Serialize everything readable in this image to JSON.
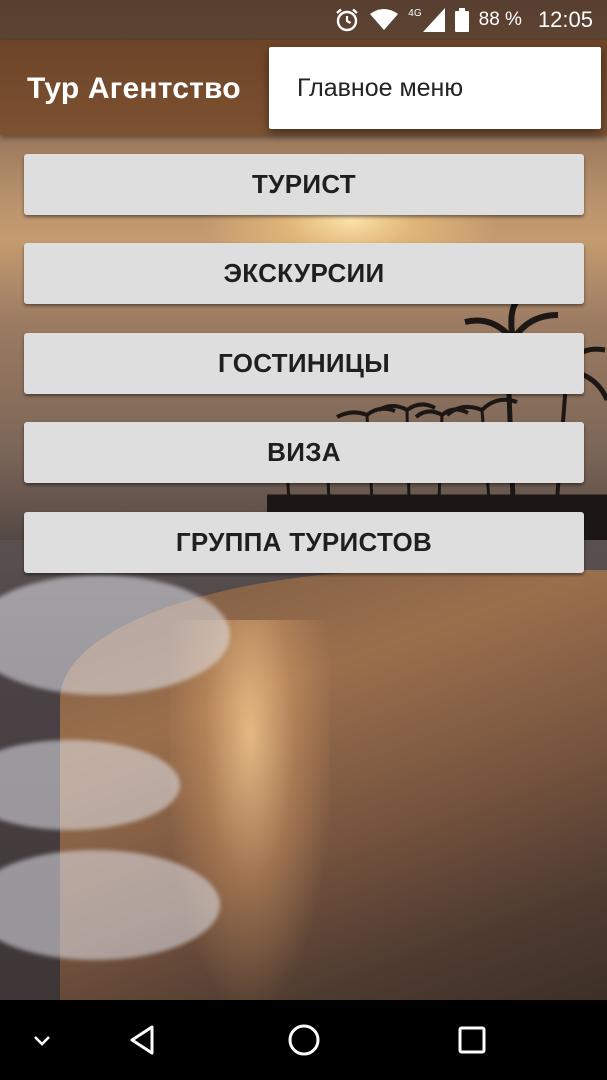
{
  "status_bar": {
    "network_type": "4G",
    "battery_percent": "88 %",
    "time": "12:05",
    "icons": [
      "alarm-icon",
      "wifi-icon",
      "signal-icon",
      "battery-icon"
    ]
  },
  "toolbar": {
    "title": "Тур Агентство"
  },
  "overflow_menu": {
    "items": [
      {
        "label": "Главное меню"
      }
    ]
  },
  "buttons": [
    {
      "label": "ТУРИСТ"
    },
    {
      "label": "ЭКСКУРСИИ"
    },
    {
      "label": "ГОСТИНИЦЫ"
    },
    {
      "label": "ВИЗА"
    },
    {
      "label": "ГРУППА ТУРИСТОВ"
    }
  ],
  "nav_bar": {
    "icons": [
      "hide-keyboard-chevron-icon",
      "back-triangle-icon",
      "home-circle-icon",
      "recents-square-icon"
    ]
  },
  "colors": {
    "toolbar": "#7a4e30",
    "button_bg": "#dedede",
    "button_text": "#1f1f1f",
    "menu_bg": "#ffffff"
  }
}
